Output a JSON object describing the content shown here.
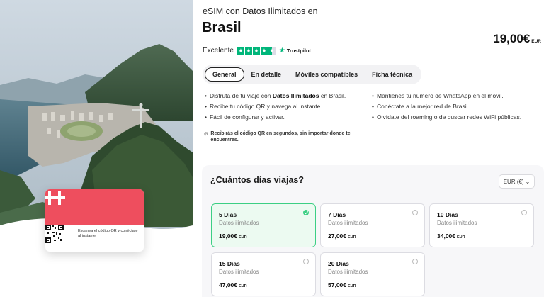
{
  "header": {
    "subtitle": "eSIM con Datos Ilimitados en",
    "title": "Brasil",
    "price": "19,00€",
    "price_currency": "EUR"
  },
  "rating": {
    "label": "Excelente",
    "stars": 4.5,
    "provider": "Trustpilot",
    "color": "#00b67a"
  },
  "tabs": [
    {
      "label": "General",
      "active": true
    },
    {
      "label": "En detalle",
      "active": false
    },
    {
      "label": "Móviles compatibles",
      "active": false
    },
    {
      "label": "Ficha técnica",
      "active": false
    }
  ],
  "features_left": [
    {
      "before": "Disfruta de tu viaje con ",
      "bold": "Datos Ilimitados",
      "after": " en Brasil."
    },
    {
      "before": "Recibe tu código QR y navega al instante.",
      "bold": "",
      "after": ""
    },
    {
      "before": "Fácil de configurar y activar.",
      "bold": "",
      "after": ""
    }
  ],
  "features_right": [
    "Mantienes tu número de WhatsApp en el móvil.",
    "Conéctate a la mejor red de Brasil.",
    "Olvídate del roaming o de buscar redes WiFi públicas."
  ],
  "note": "Recibirás el código QR en segundos, sin importar donde te encuentres.",
  "card": {
    "text": "Escanea el código QR y conéctate al instante",
    "brand_color": "#ee4e5e"
  },
  "days_panel": {
    "title": "¿Cuántos días viajas?",
    "currency_select": "EUR (€)",
    "options": [
      {
        "days": "5 Días",
        "data": "Datos ilimitados",
        "price": "19,00€",
        "currency": "EUR",
        "selected": true
      },
      {
        "days": "7 Días",
        "data": "Datos ilimitados",
        "price": "27,00€",
        "currency": "EUR",
        "selected": false
      },
      {
        "days": "10 Días",
        "data": "Datos ilimitados",
        "price": "34,00€",
        "currency": "EUR",
        "selected": false
      },
      {
        "days": "15 Días",
        "data": "Datos ilimitados",
        "price": "47,00€",
        "currency": "EUR",
        "selected": false
      },
      {
        "days": "20 Días",
        "data": "Datos ilimitados",
        "price": "57,00€",
        "currency": "EUR",
        "selected": false
      }
    ]
  },
  "colors": {
    "selected_border": "#3ccf84",
    "selected_bg": "#ecfaf1"
  }
}
